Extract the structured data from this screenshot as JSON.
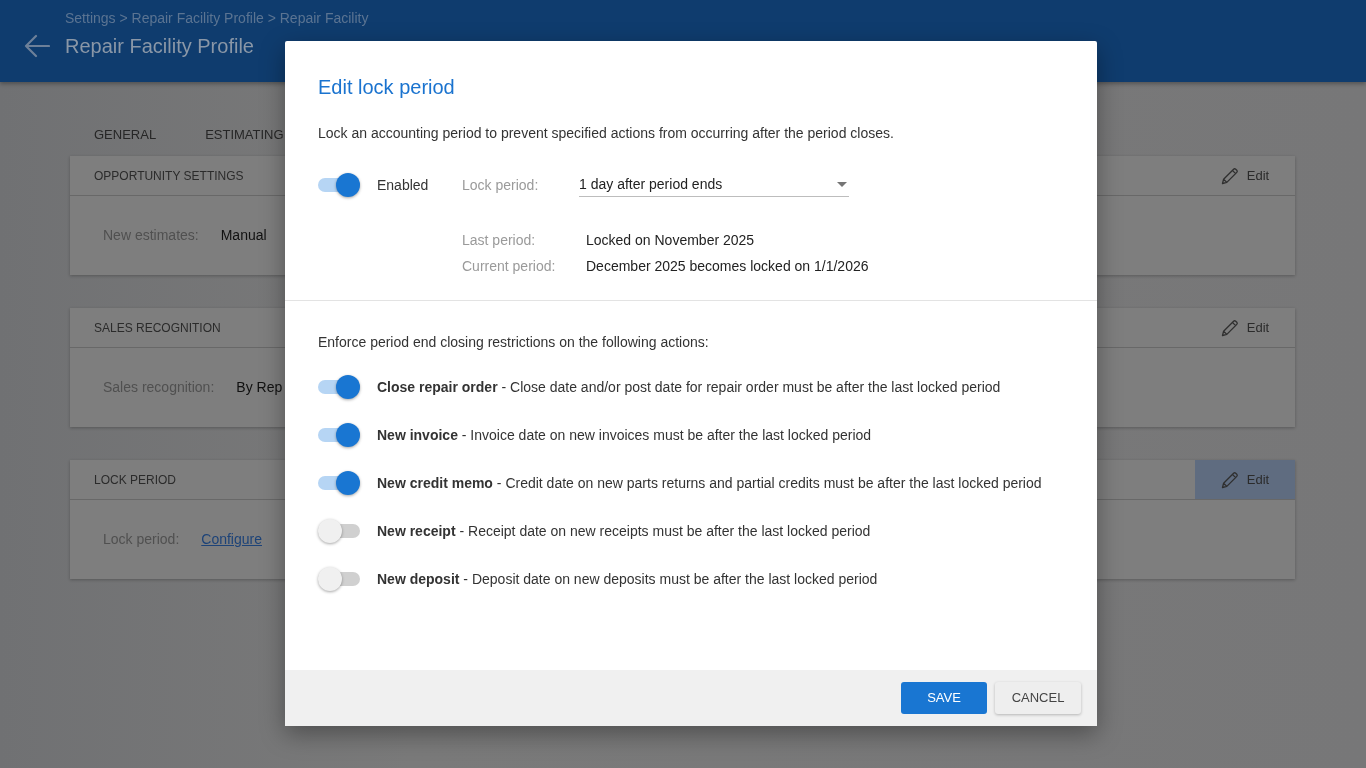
{
  "header": {
    "breadcrumb": "Settings > Repair Facility Profile > Repair Facility",
    "title": "Repair Facility Profile"
  },
  "tabs": [
    {
      "label": "GENERAL"
    },
    {
      "label": "ESTIMATING"
    }
  ],
  "cards": [
    {
      "title": "OPPORTUNITY SETTINGS",
      "edit": "Edit",
      "hovered": false,
      "field": {
        "label": "New estimates:",
        "value": "Manual",
        "kind": "text"
      }
    },
    {
      "title": "SALES RECOGNITION",
      "edit": "Edit",
      "hovered": false,
      "field": {
        "label": "Sales recognition:",
        "value": "By Rep",
        "kind": "text"
      }
    },
    {
      "title": "LOCK PERIOD",
      "edit": "Edit",
      "hovered": true,
      "field": {
        "label": "Lock period:",
        "value": "Configure",
        "kind": "link"
      }
    }
  ],
  "dialog": {
    "title": "Edit lock period",
    "description": "Lock an accounting period to prevent specified actions from occurring after the period closes.",
    "enabled": {
      "label": "Enabled",
      "on": true
    },
    "lock_period": {
      "label": "Lock period:",
      "value": "1 day after period ends"
    },
    "periods": [
      {
        "label": "Last period:",
        "value": "Locked on November 2025"
      },
      {
        "label": "Current period:",
        "value": "December 2025 becomes locked on 1/1/2026"
      }
    ],
    "restrictions_heading": "Enforce period end closing restrictions on the following actions:",
    "restrictions": [
      {
        "text": "**Close repair order** - Close date and/or post date for repair order must be after the last locked period",
        "on": true
      },
      {
        "text": "**New invoice** - Invoice date on new invoices must be after the last locked period",
        "on": true
      },
      {
        "text": "**New credit memo** - Credit date on new parts returns and partial credits must be after the last locked period",
        "on": true
      },
      {
        "text": "**New receipt** - Receipt date on new receipts must be after the last locked period",
        "on": false
      },
      {
        "text": "**New deposit** - Deposit date on new deposits must be after the last locked period",
        "on": false
      }
    ],
    "buttons": [
      {
        "label": "SAVE",
        "kind": "primary"
      },
      {
        "label": "CANCEL",
        "kind": "secondary"
      }
    ]
  }
}
